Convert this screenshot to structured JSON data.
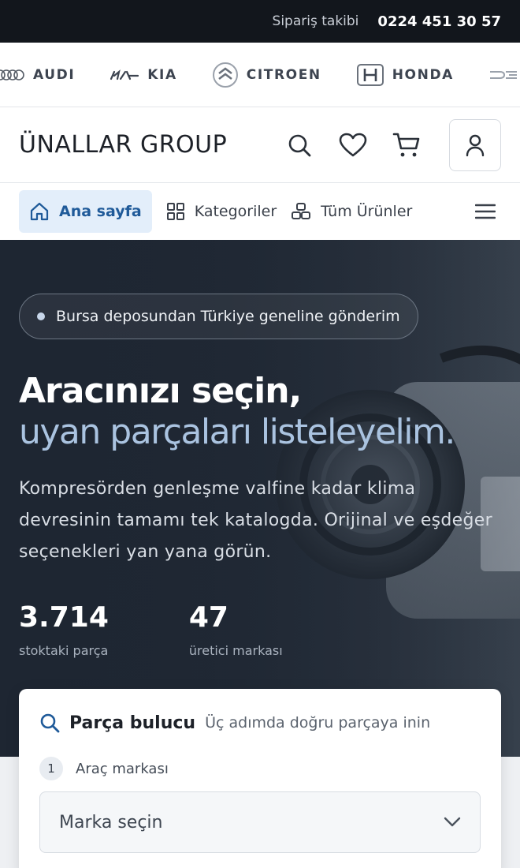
{
  "topbar": {
    "track_label": "Sipariş takibi",
    "phone": "0224 451 30 57"
  },
  "brands": [
    {
      "name": "AUDI",
      "icon": "audi-logo"
    },
    {
      "name": "KIA",
      "icon": "kia-logo"
    },
    {
      "name": "CITROEN",
      "icon": "citroen-logo"
    },
    {
      "name": "HONDA",
      "icon": "honda-logo"
    }
  ],
  "header": {
    "logo": "ÜNALLAR GROUP"
  },
  "nav": {
    "items": [
      {
        "label": "Ana sayfa",
        "icon": "home-icon",
        "active": true
      },
      {
        "label": "Kategoriler",
        "icon": "grid-icon"
      },
      {
        "label": "Tüm Ürünler",
        "icon": "products-icon"
      }
    ]
  },
  "hero": {
    "badge": "Bursa deposundan Türkiye geneline gönderim",
    "title_line1": "Aracınızı seçin,",
    "title_line2": "uyan parçaları listeleyelim.",
    "lead": "Kompresörden genleşme valfine kadar klima devresinin tamamı tek katalogda. Orijinal ve eşdeğer seçenekleri yan yana görün.",
    "stats": [
      {
        "value": "3.714",
        "label": "stoktaki parça"
      },
      {
        "value": "47",
        "label": "üretici markası"
      }
    ]
  },
  "finder": {
    "title": "Parça bulucu",
    "subtitle": "Üç adımda doğru parçaya inin",
    "step_number": "1",
    "step_label": "Araç markası",
    "select_placeholder": "Marka seçin"
  },
  "colors": {
    "topbar_bg": "#12161c",
    "accent": "#1f5a99",
    "active_nav_bg": "#e3eefa",
    "hero_bg": "#232c38",
    "hero_title_accent": "#aac3e0"
  }
}
